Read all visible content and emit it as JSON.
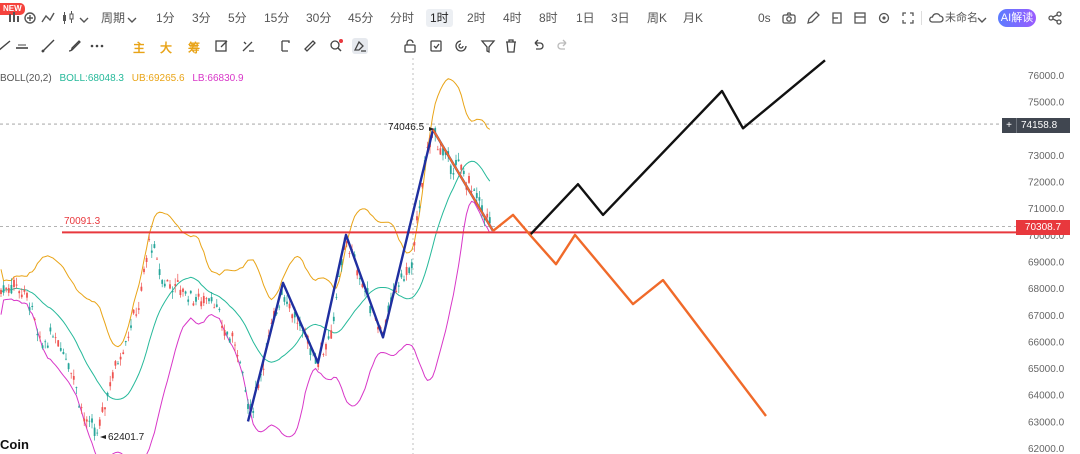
{
  "toolbar": {
    "badge": "NEW",
    "period_label": "周期",
    "intervals": [
      "1分",
      "3分",
      "5分",
      "15分",
      "30分",
      "45分",
      "分时",
      "1时",
      "2时",
      "4时",
      "8时",
      "1日",
      "3日",
      "周K",
      "月K"
    ],
    "active_interval": "1时",
    "timer": "0s",
    "layout_name": "未命名",
    "ai_label": "AI解读"
  },
  "drawbar": {
    "main_label": "主",
    "big_label": "大",
    "chip_label": "筹"
  },
  "indicator": {
    "name": "BOLL(20,2)",
    "boll": "BOLL:68048.3",
    "ub": "UB:69265.6",
    "lb": "LB:66830.9",
    "colors": {
      "boll": "#26b99a",
      "ub": "#e9a417",
      "lb": "#d837c8"
    }
  },
  "chart_data": {
    "type": "candlestick",
    "y_axis": {
      "range": [
        62000,
        76600
      ],
      "ticks": [
        "76000.0",
        "75000.0",
        "74000.0",
        "73000.0",
        "72000.0",
        "71000.0",
        "70000.0",
        "69000.0",
        "68000.0",
        "67000.0",
        "66000.0",
        "65000.0",
        "64000.0",
        "63000.0",
        "62000.0"
      ]
    },
    "price_labels": {
      "current": "74158.8",
      "support": "70308.7",
      "support_line_label": "70091.3",
      "high_marker": "74046.5",
      "low_marker": "62401.7"
    },
    "colors": {
      "up": "#26a69a",
      "down": "#ef5350",
      "support_line": "#e8383d",
      "zigzag": "#1f2fa0",
      "bull_path": "#111111",
      "bear_path": "#f06a2a"
    },
    "brand_text": "Coin"
  }
}
